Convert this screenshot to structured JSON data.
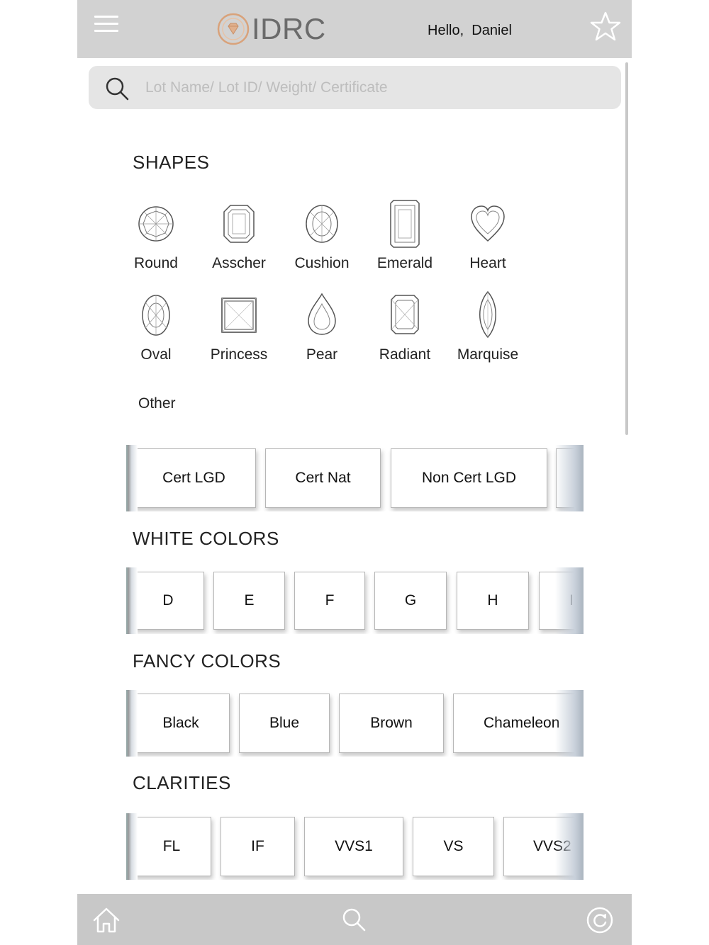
{
  "header": {
    "logo_text": "IDRC",
    "greeting": "Hello,  Daniel",
    "icons": {
      "menu": "hamburger-menu-icon",
      "favorite": "star-icon",
      "logo": "diamond-logo-icon"
    },
    "colors": {
      "bar": "#d2d2d2",
      "logo_accent": "#d9a27a"
    }
  },
  "search": {
    "placeholder": "Lot Name/ Lot ID/ Weight/ Certificate"
  },
  "shapes": {
    "title": "SHAPES",
    "items": [
      "Round",
      "Asscher",
      "Cushion",
      "Emerald",
      "Heart",
      "Oval",
      "Princess",
      "Pear",
      "Radiant",
      "Marquise"
    ],
    "other": "Other"
  },
  "cert_types": {
    "items": [
      "Cert LGD",
      "Cert Nat",
      "Non Cert LGD"
    ]
  },
  "white_colors": {
    "title": "WHITE COLORS",
    "items": [
      "D",
      "E",
      "F",
      "G",
      "H",
      "I"
    ]
  },
  "fancy_colors": {
    "title": "FANCY COLORS",
    "items": [
      "Black",
      "Blue",
      "Brown",
      "Chameleon"
    ]
  },
  "clarities": {
    "title": "CLARITIES",
    "items": [
      "FL",
      "IF",
      "VVS1",
      "VS",
      "VVS2"
    ]
  },
  "footer": {
    "icons": [
      "home-icon",
      "search-icon",
      "refresh-icon"
    ],
    "color": "#c8c8c8"
  }
}
